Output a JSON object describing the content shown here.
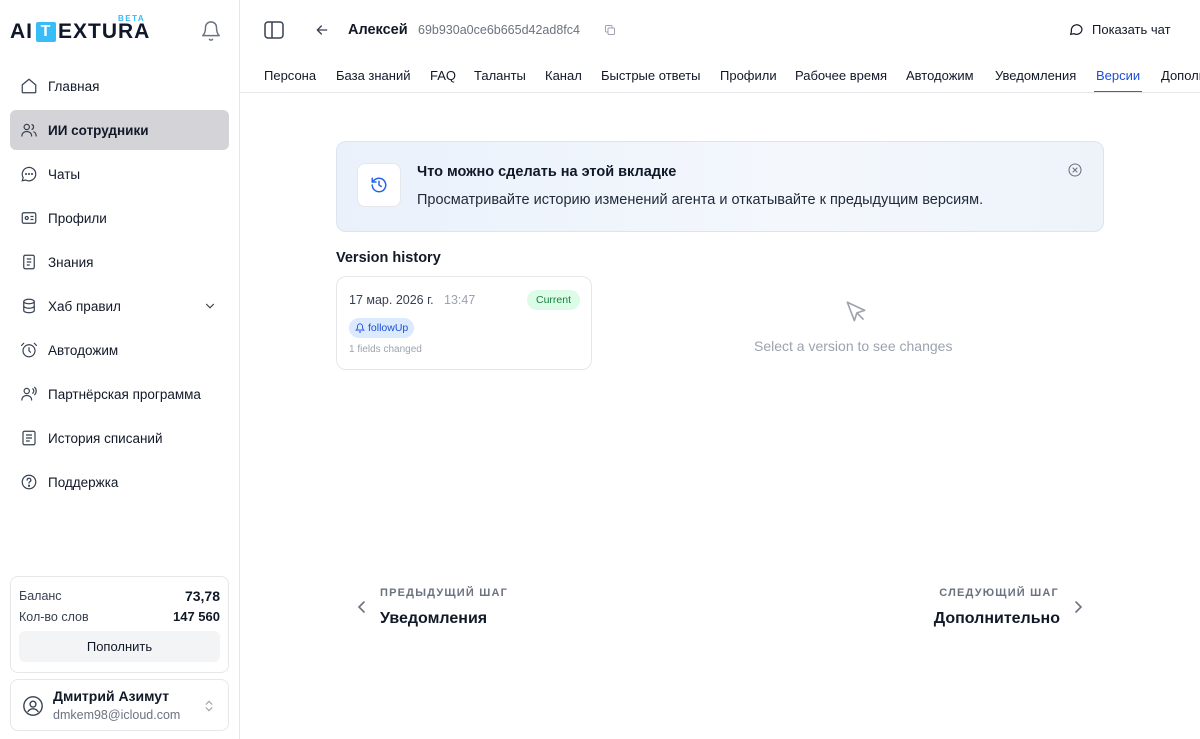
{
  "brand": {
    "logo_left": "AI",
    "logo_box": "T",
    "logo_right": "EXTURA",
    "beta": "BETA"
  },
  "sidebar": {
    "items": [
      {
        "label": "Главная",
        "icon": "home-icon"
      },
      {
        "label": "ИИ сотрудники",
        "icon": "users-icon",
        "active": true
      },
      {
        "label": "Чаты",
        "icon": "chat-icon"
      },
      {
        "label": "Профили",
        "icon": "id-card-icon"
      },
      {
        "label": "Знания",
        "icon": "document-icon"
      },
      {
        "label": "Хаб правил",
        "icon": "database-icon",
        "expandable": true
      },
      {
        "label": "Автодожим",
        "icon": "alarm-clock-icon"
      },
      {
        "label": "Партнёрская программа",
        "icon": "partner-icon"
      },
      {
        "label": "История списаний",
        "icon": "receipt-icon"
      },
      {
        "label": "Поддержка",
        "icon": "help-icon"
      }
    ]
  },
  "balance": {
    "balance_label": "Баланс",
    "balance_value": "73,78",
    "words_label": "Кол-во слов",
    "words_value": "147 560",
    "topup_label": "Пополнить"
  },
  "user": {
    "name": "Дмитрий Азимут",
    "email": "dmkem98@icloud.com"
  },
  "header": {
    "agent_name": "Алексей",
    "agent_id": "69b930a0ce6b665d42ad8fc4",
    "show_chat_label": "Показать чат"
  },
  "tabs": [
    {
      "label": "Персона"
    },
    {
      "label": "База знаний"
    },
    {
      "label": "FAQ"
    },
    {
      "label": "Таланты"
    },
    {
      "label": "Канал"
    },
    {
      "label": "Быстрые ответы"
    },
    {
      "label": "Профили"
    },
    {
      "label": "Рабочее время"
    },
    {
      "label": "Автодожим"
    },
    {
      "label": "Уведомления"
    },
    {
      "label": "Версии",
      "active": true
    },
    {
      "label": "Дополнительно"
    }
  ],
  "info": {
    "title": "Что можно сделать на этой вкладке",
    "description": "Просматривайте историю изменений агента и откатывайте к предыдущим версиям."
  },
  "versions": {
    "title": "Version history",
    "items": [
      {
        "date": "17 мар. 2026 г.",
        "time": "13:47",
        "badge": "Current",
        "tag": "followUp",
        "changed": "1 fields changed"
      }
    ],
    "empty_text": "Select a version to see changes"
  },
  "footer_nav": {
    "prev_caption": "ПРЕДЫДУЩИЙ ШАГ",
    "prev_label": "Уведомления",
    "next_caption": "СЛЕДУЮЩИЙ ШАГ",
    "next_label": "Дополнительно"
  },
  "colors": {
    "accent": "#2563eb",
    "active_nav_bg": "#d4d4d8",
    "badge_green": "#dcfce7",
    "tag_blue": "#dbeafe",
    "logo_blue": "#38bdf8"
  }
}
